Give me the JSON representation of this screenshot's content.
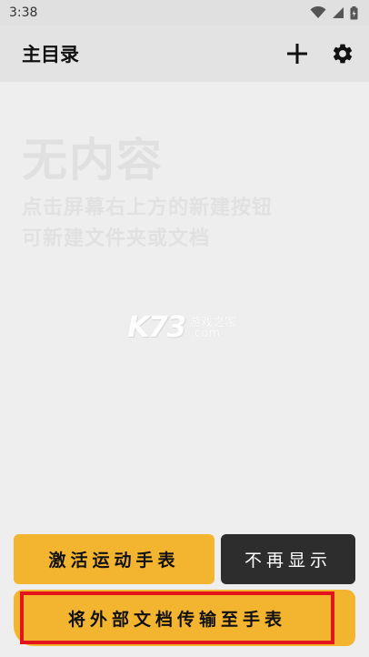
{
  "status_bar": {
    "time": "3:38",
    "icons": [
      "wifi-icon",
      "signal-icon",
      "battery-icon"
    ]
  },
  "app_bar": {
    "title": "主目录",
    "actions": [
      "add-icon",
      "gear-icon"
    ]
  },
  "empty_state": {
    "title": "无内容",
    "description_lines": [
      "点击屏幕右上方的新建按钮",
      "可新建文件夹或文档"
    ]
  },
  "watermark": {
    "logo": "K73",
    "site_name": "游戏之家",
    "domain": ".com"
  },
  "buttons": {
    "activate": "激活运动手表",
    "dismiss": "不再显示",
    "transfer": "将外部文档传输至手表"
  },
  "colors": {
    "accent": "#f3b52f",
    "dark_button": "#2d2d2d",
    "highlight_border": "#e3141b",
    "background": "#eeeeee"
  }
}
